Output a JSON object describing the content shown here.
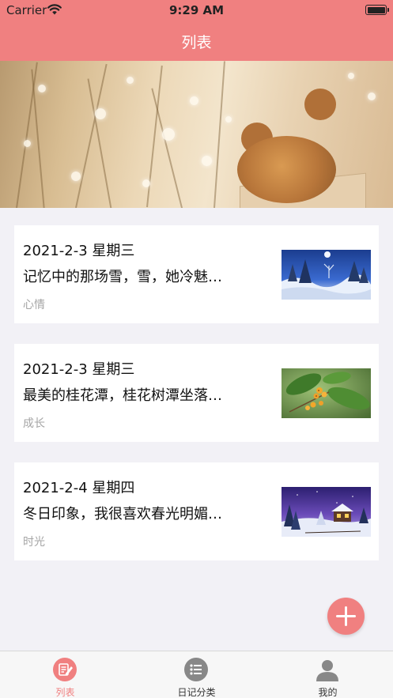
{
  "status_bar": {
    "carrier": "Carrier",
    "time": "9:29 AM"
  },
  "nav": {
    "title": "列表"
  },
  "entries": [
    {
      "date": "2021-2-3  星期三",
      "snippet": "记忆中的那场雪，雪，她冷魅…",
      "tag": "心情",
      "thumb_icon": "snow-night-forest-photo"
    },
    {
      "date": "2021-2-3  星期三",
      "snippet": "最美的桂花潭，桂花树潭坐落…",
      "tag": "成长",
      "thumb_icon": "osmanthus-flower-photo"
    },
    {
      "date": "2021-2-4  星期四",
      "snippet": "冬日印象，我很喜欢春光明媚…",
      "tag": "时光",
      "thumb_icon": "winter-cabin-photo"
    }
  ],
  "fab": {
    "icon": "plus-icon"
  },
  "tabs": [
    {
      "label": "列表",
      "icon": "list-edit-icon",
      "active": true
    },
    {
      "label": "日记分类",
      "icon": "category-list-icon",
      "active": false
    },
    {
      "label": "我的",
      "icon": "person-icon",
      "active": false
    }
  ],
  "colors": {
    "accent": "#f08080",
    "tag_text": "#a5a5a5",
    "background": "#f2f1f6"
  }
}
